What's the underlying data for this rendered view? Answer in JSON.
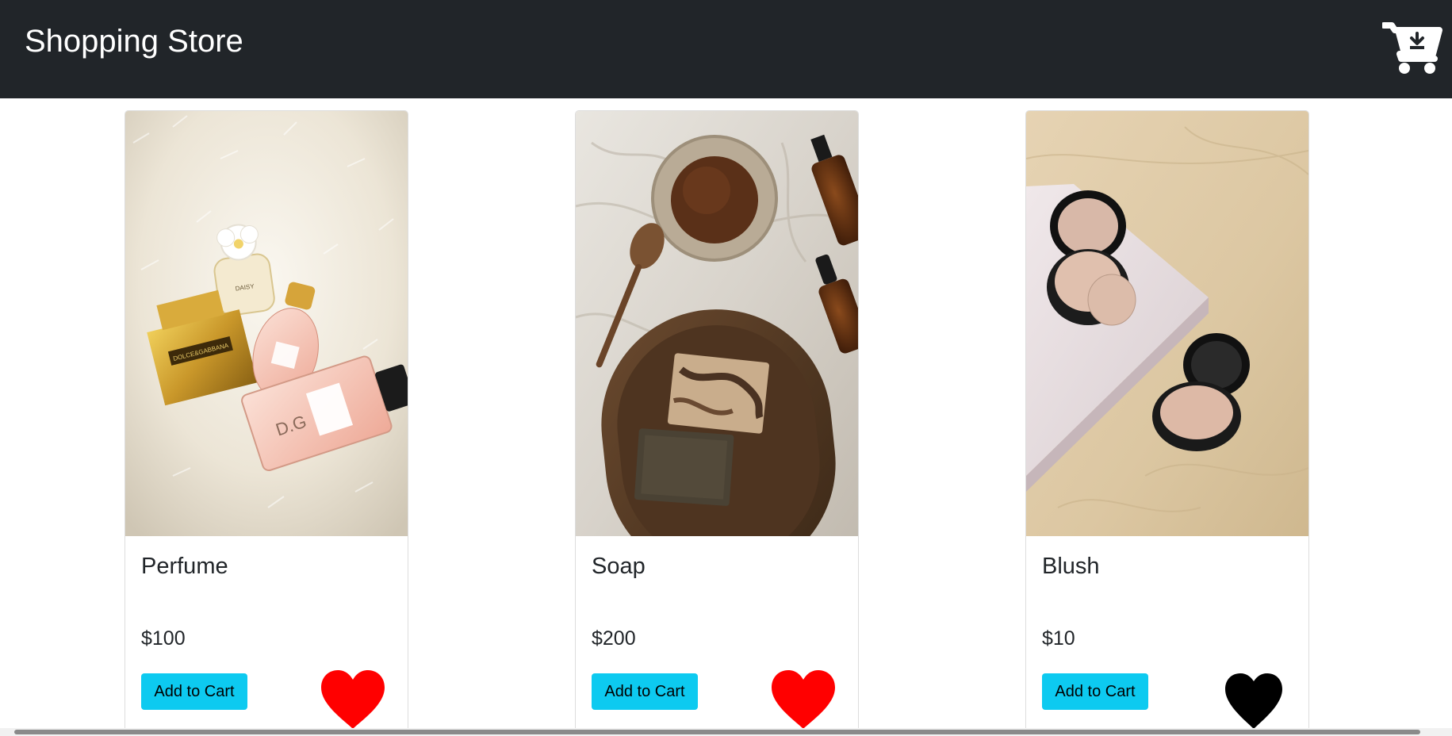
{
  "navbar": {
    "brand": "Shopping Store",
    "cart_icon": "cart-download-icon",
    "background": "#212529"
  },
  "products": [
    {
      "name": "Perfume",
      "price": "$100",
      "button_label": "Add to Cart",
      "favorite_icon": "heart-icon",
      "favorite_color": "#ff0000",
      "favorited": true
    },
    {
      "name": "Soap",
      "price": "$200",
      "button_label": "Add to Cart",
      "favorite_icon": "heart-icon",
      "favorite_color": "#ff0000",
      "favorited": true
    },
    {
      "name": "Blush",
      "price": "$10",
      "button_label": "Add to Cart",
      "favorite_icon": "heart-icon",
      "favorite_color": "#000000",
      "favorited": false
    }
  ],
  "colors": {
    "button": "#0dcaf0",
    "text": "#212529"
  }
}
